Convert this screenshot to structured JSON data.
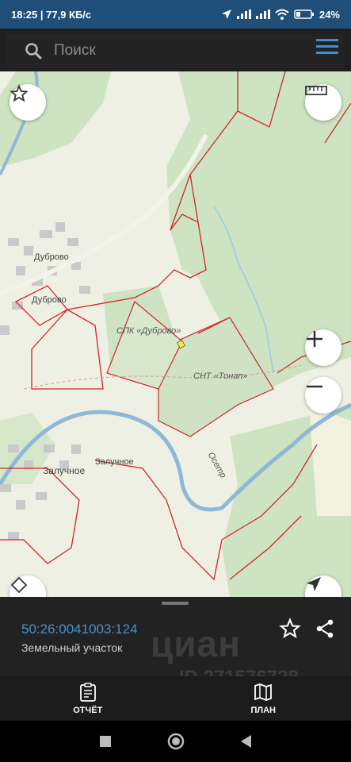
{
  "status_bar": {
    "time_speed": "18:25 | 77,9 КБ/с",
    "battery": "24%"
  },
  "search": {
    "placeholder": "Поиск"
  },
  "map": {
    "labels": {
      "dubrovo_1": "Дуброво",
      "dubrovo_2": "Дуброво",
      "spk": "СПК «Дуброво»",
      "snt": "СНТ «Тонап»",
      "zaluchnoe_1": "Залучное",
      "zaluchnoe_2": "Залучное",
      "river": "Осетр"
    }
  },
  "parcel": {
    "cadastral_number": "50:26:0041003:124",
    "type": "Земельный участок"
  },
  "watermark": {
    "logo": "циан",
    "id": "ID 271576728"
  },
  "tabs": {
    "report": "ОТЧЁТ",
    "plan": "ПЛАН"
  },
  "colors": {
    "status_bar": "#1f4e78",
    "accent_blue": "#3d8fd6",
    "forest": "#cde3c1",
    "parcel_border": "#d3262b"
  }
}
